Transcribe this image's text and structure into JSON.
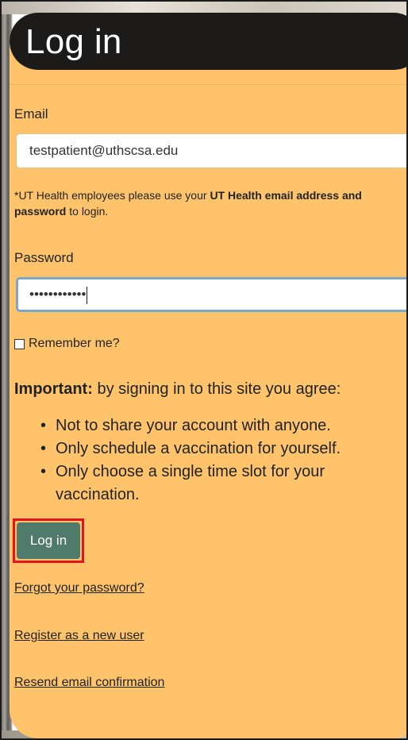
{
  "page": {
    "title": "Log in"
  },
  "form": {
    "email_label": "Email",
    "email_value": "testpatient@uthscsa.edu",
    "note_prefix": "*UT Health employees please use your ",
    "note_bold": "UT Health email address and password",
    "note_suffix": " to login.",
    "password_label": "Password",
    "password_value": "••••••••••••",
    "remember_label": "Remember me?",
    "submit_label": "Log in"
  },
  "important": {
    "bold": "Important:",
    "text": " by signing in to this site you agree:",
    "items": [
      "Not to share your account with anyone.",
      "Only schedule a vaccination for yourself.",
      "Only choose a single time slot for your vaccination."
    ]
  },
  "links": {
    "forgot": "Forgot your password?",
    "register": "Register as a new user",
    "resend": "Resend email confirmation"
  },
  "colors": {
    "panel": "#ffc46b",
    "title_bar": "#1c1b1a",
    "button": "#507a6b",
    "highlight": "#e3141e"
  }
}
